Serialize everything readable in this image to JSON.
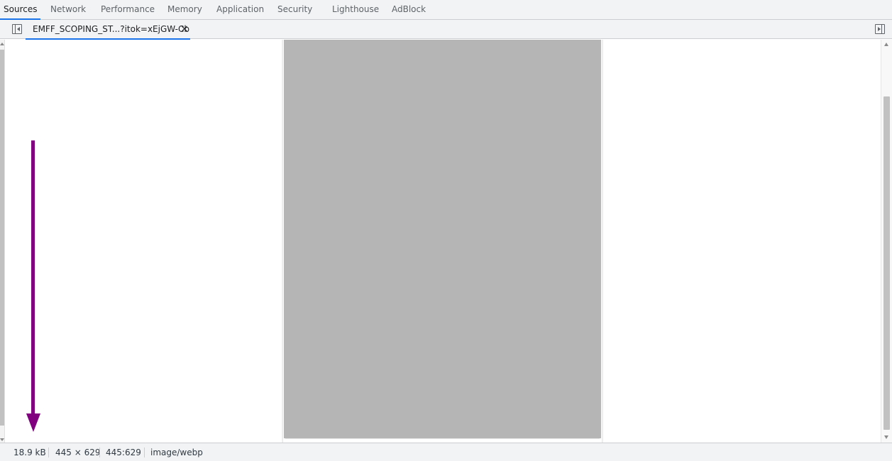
{
  "top_tabs": [
    {
      "label": "Sources",
      "active": true
    },
    {
      "label": "Network",
      "active": false
    },
    {
      "label": "Performance",
      "active": false
    },
    {
      "label": "Memory",
      "active": false
    },
    {
      "label": "Application",
      "active": false
    },
    {
      "label": "Security",
      "active": false
    },
    {
      "label": "Lighthouse",
      "active": false
    },
    {
      "label": "AdBlock",
      "active": false
    }
  ],
  "file_tab": {
    "label": "EMFF_SCOPING_ST...?itok=xEjGW-Cb",
    "close_glyph": "×"
  },
  "viewer": {
    "image_placeholder_color": "#b5b5b5",
    "annotation_arrow_color": "#800080",
    "annotation_arrow_direction": "down"
  },
  "status_bar": {
    "size": "18.9 kB",
    "dimensions": "445 × 629",
    "aspect": "445:629",
    "mime": "image/webp"
  },
  "colors": {
    "accent": "#1a73e8",
    "toolbar_bg": "#f1f3f4"
  },
  "icons": {
    "show_navigator": "sidebar-left-toggle-icon",
    "show_debugger": "sidebar-right-toggle-icon"
  }
}
